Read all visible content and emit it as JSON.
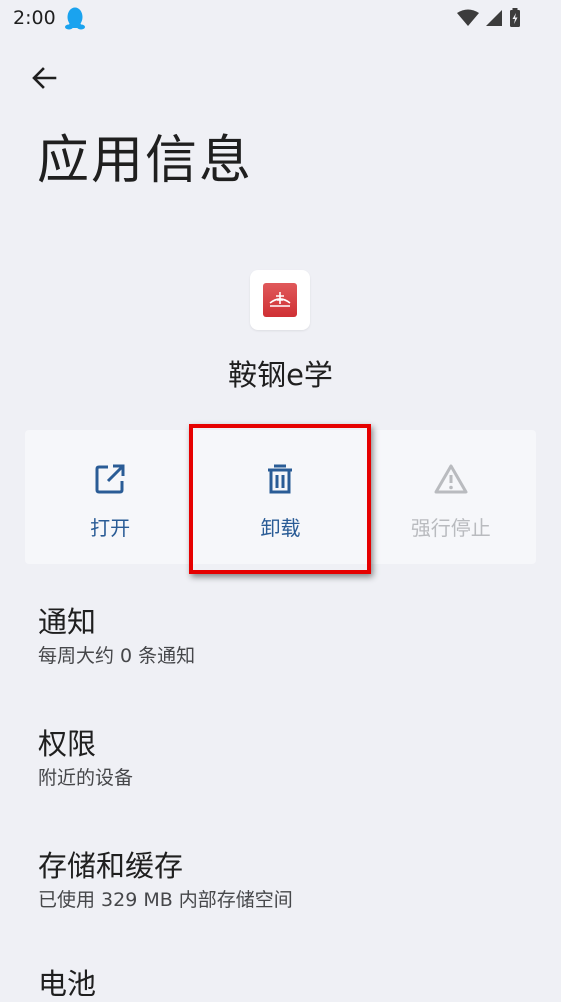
{
  "status_bar": {
    "time": "2:00",
    "notification_icon": "qq-penguin-icon",
    "icons": [
      "wifi-icon",
      "signal-icon",
      "battery-charging-icon"
    ]
  },
  "header": {
    "back_icon": "back-arrow-icon",
    "title": "应用信息"
  },
  "app": {
    "icon": "app-logo-icon",
    "name": "鞍钢e学"
  },
  "actions": [
    {
      "label": "打开",
      "icon": "open-external-icon",
      "enabled": true
    },
    {
      "label": "卸载",
      "icon": "trash-icon",
      "enabled": true
    },
    {
      "label": "强行停止",
      "icon": "warning-icon",
      "enabled": false
    }
  ],
  "settings": [
    {
      "title": "通知",
      "subtitle": "每周大约 0 条通知"
    },
    {
      "title": "权限",
      "subtitle": "附近的设备"
    },
    {
      "title": "存储和缓存",
      "subtitle": "已使用 329 MB 内部存储空间"
    },
    {
      "title": "电池",
      "subtitle": ""
    }
  ],
  "colors": {
    "background": "#eff0f5",
    "accent": "#2a5c96",
    "disabled": "#b9bbbf",
    "highlight": "#e60000"
  }
}
